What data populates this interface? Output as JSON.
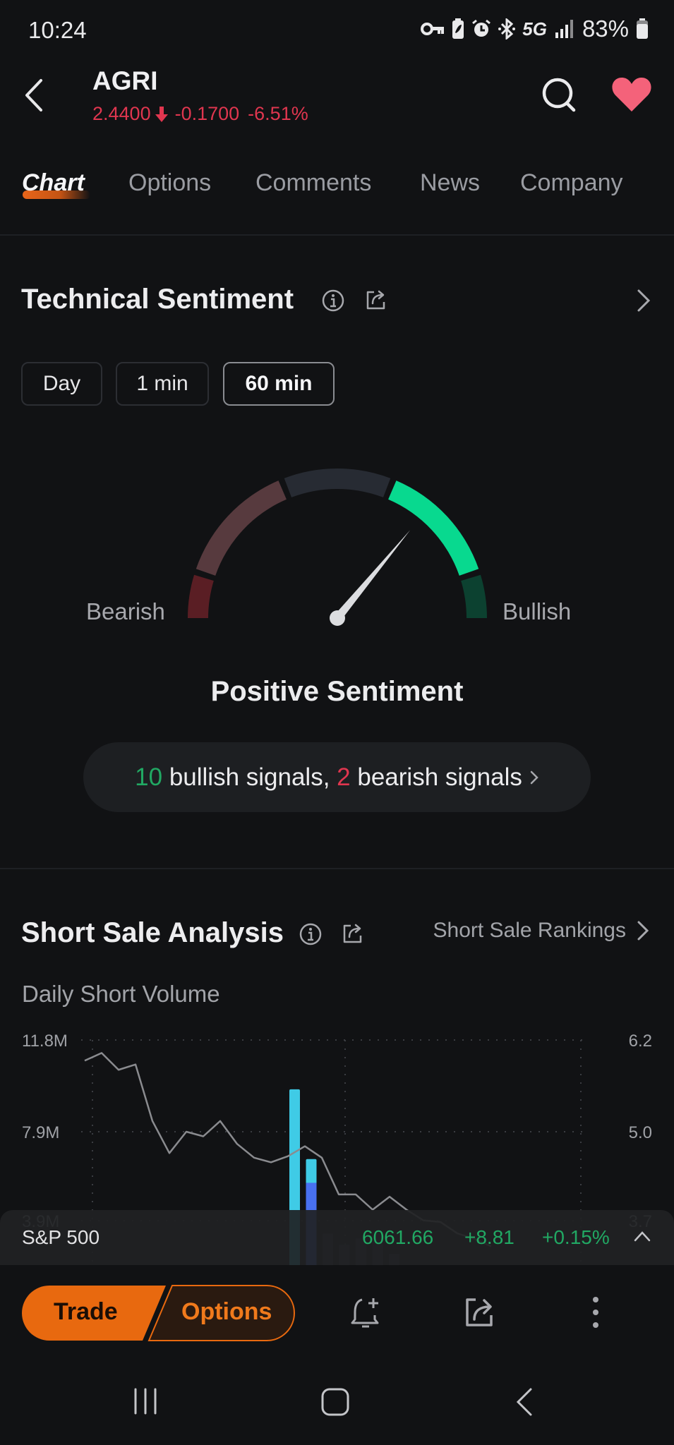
{
  "status_bar": {
    "time": "10:24",
    "battery": "83%",
    "network": "5G",
    "icons": [
      "vpn-key-icon",
      "battery-saver-icon",
      "alarm-icon",
      "bluetooth-icon",
      "5g-icon",
      "signal-icon",
      "battery-icon"
    ]
  },
  "header": {
    "ticker": "AGRI",
    "price": "2.4400",
    "change": "-0.1700",
    "change_pct": "-6.51%",
    "direction": "down",
    "favorited": true,
    "colors": {
      "down": "#e0364f",
      "heart": "#f4627a"
    }
  },
  "tabs": [
    {
      "label": "Chart",
      "active": true
    },
    {
      "label": "Options",
      "active": false
    },
    {
      "label": "Comments",
      "active": false
    },
    {
      "label": "News",
      "active": false
    },
    {
      "label": "Company",
      "active": false
    }
  ],
  "technical_sentiment": {
    "title": "Technical Sentiment",
    "periods": [
      {
        "label": "Day",
        "selected": false
      },
      {
        "label": "1 min",
        "selected": false
      },
      {
        "label": "60 min",
        "selected": true
      }
    ],
    "gauge": {
      "left_label": "Bearish",
      "right_label": "Bullish",
      "active_segment": 3,
      "needle_value": 0.72,
      "segment_colors": [
        "#5a1e24",
        "#573a3e",
        "#272b33",
        "#08d98f",
        "#0c4130"
      ]
    },
    "sentiment": "Positive Sentiment",
    "bullish_count": "10",
    "bullish_text": "bullish signals,",
    "bearish_count": "2",
    "bearish_text": "bearish signals"
  },
  "short_sale": {
    "title": "Short Sale Analysis",
    "rankings_link": "Short Sale Rankings",
    "subtitle": "Daily Short Volume"
  },
  "chart_data": {
    "type": "bar+line",
    "title": "Daily Short Volume",
    "left_axis": {
      "ticks": [
        "11.8M",
        "7.9M",
        "3.9M"
      ],
      "range_millions": [
        0,
        15.7
      ]
    },
    "right_axis": {
      "ticks": [
        "6.2",
        "5.0",
        "3.7"
      ],
      "range": [
        1.2,
        7.4
      ]
    },
    "grid": true,
    "bars": [
      {
        "index": 9,
        "total_millions": 11.4,
        "segment_millions": 11.4
      },
      {
        "index": 10,
        "total_millions": 7.0,
        "segment_millions": 5.5
      }
    ],
    "bars_obscured": [
      {
        "index": 11,
        "total_millions": 2.3
      },
      {
        "index": 12,
        "total_millions": 1.6
      },
      {
        "index": 13,
        "total_millions": 2.0
      },
      {
        "index": 14,
        "total_millions": 2.3
      },
      {
        "index": 15,
        "total_millions": 1.0
      }
    ],
    "line_series": {
      "name": "Price",
      "values": [
        5.93,
        6.03,
        5.81,
        5.88,
        5.14,
        4.72,
        5.0,
        4.94,
        5.14,
        4.84,
        4.66,
        4.6,
        4.68,
        4.81,
        4.66,
        4.18,
        4.18,
        3.98,
        4.15,
        3.98,
        3.84,
        3.82,
        3.67,
        3.6,
        3.5
      ]
    },
    "series_colors": {
      "bar_total": "#3fcbe6",
      "bar_segment": "#4870f0",
      "line": "#8a8b8f"
    }
  },
  "index_ticker": {
    "name": "S&P 500",
    "value": "6061.66",
    "change": "+8.81",
    "change_pct": "+0.15%",
    "color": "#21a863"
  },
  "toolbar": {
    "trade_label": "Trade",
    "options_label": "Options",
    "accent": "#e8690f"
  },
  "nav": [
    "recent-apps",
    "home",
    "back"
  ]
}
